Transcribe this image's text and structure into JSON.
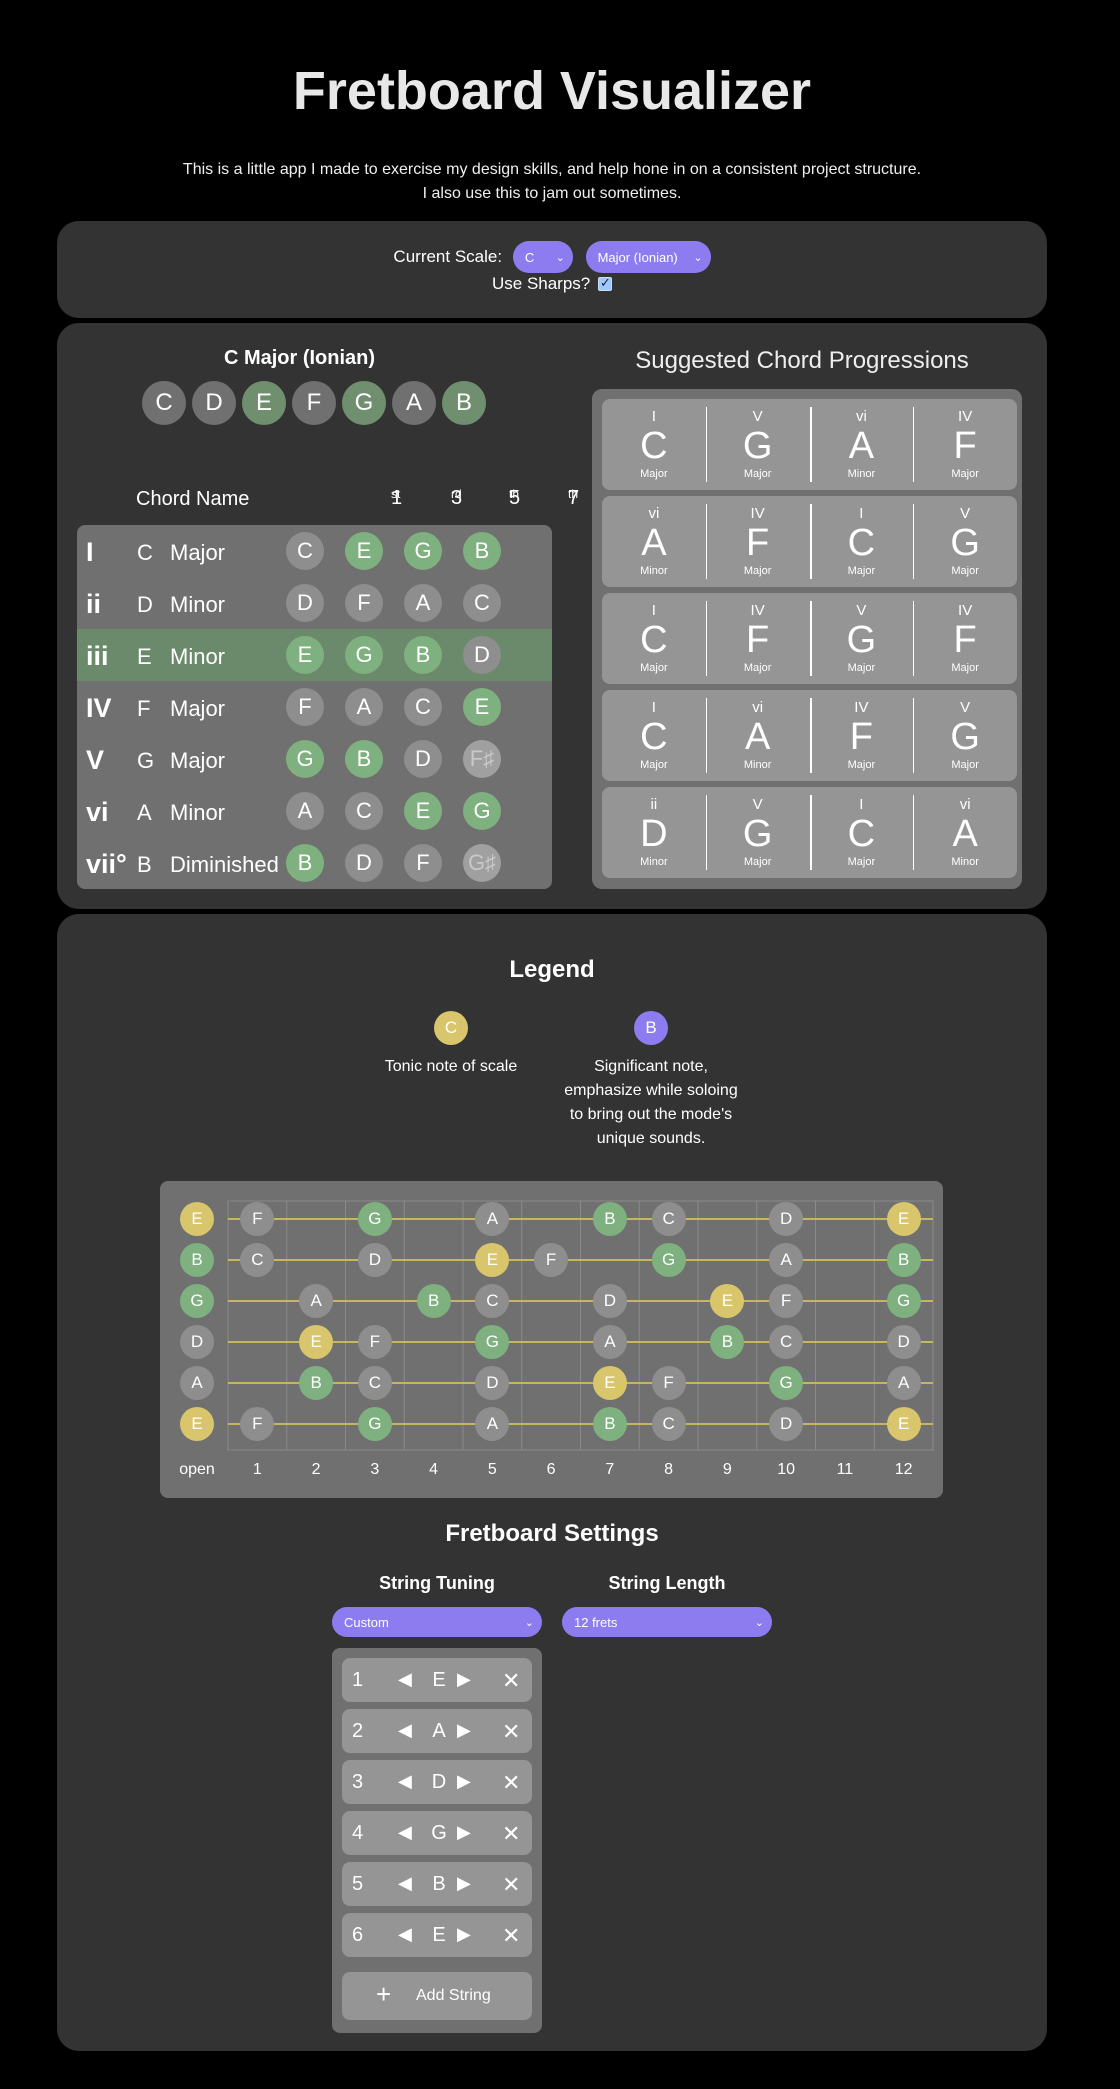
{
  "header": {
    "title": "Fretboard Visualizer",
    "intro_line1": "This is a little app I made to exercise my design skills, and help hone in on a consistent project structure.",
    "intro_line2": "I also use this to jam out sometimes."
  },
  "scale_controls": {
    "label": "Current Scale:",
    "key_value": "C",
    "mode_value": "Major (Ionian)",
    "sharps_label": "Use Sharps?",
    "sharps_checked": true
  },
  "scale": {
    "name": "C Major (Ionian)",
    "notes": [
      "C",
      "D",
      "E",
      "F",
      "G",
      "A",
      "B"
    ],
    "highlighted_notes": [
      "E",
      "G",
      "B"
    ]
  },
  "chord_table": {
    "header_name": "Chord Name",
    "interval_headers": [
      {
        "num": "1",
        "sup": "st"
      },
      {
        "num": "3",
        "sup": "rd"
      },
      {
        "num": "5",
        "sup": "th"
      },
      {
        "num": "7",
        "sup": "th"
      }
    ],
    "highlighted_row": 2,
    "rows": [
      {
        "numeral": "I",
        "root": "C",
        "quality": "Major",
        "notes": [
          "C",
          "E",
          "G",
          "B"
        ],
        "states": [
          "g",
          "s",
          "s",
          "s"
        ]
      },
      {
        "numeral": "ii",
        "root": "D",
        "quality": "Minor",
        "notes": [
          "D",
          "F",
          "A",
          "C"
        ],
        "states": [
          "g",
          "g",
          "g",
          "g"
        ]
      },
      {
        "numeral": "iii",
        "root": "E",
        "quality": "Minor",
        "notes": [
          "E",
          "G",
          "B",
          "D"
        ],
        "states": [
          "s",
          "s",
          "s",
          "g"
        ]
      },
      {
        "numeral": "IV",
        "root": "F",
        "quality": "Major",
        "notes": [
          "F",
          "A",
          "C",
          "E"
        ],
        "states": [
          "g",
          "g",
          "g",
          "s"
        ]
      },
      {
        "numeral": "V",
        "root": "G",
        "quality": "Major",
        "notes": [
          "G",
          "B",
          "D",
          "F♯"
        ],
        "states": [
          "s",
          "s",
          "g",
          "o"
        ]
      },
      {
        "numeral": "vi",
        "root": "A",
        "quality": "Minor",
        "notes": [
          "A",
          "C",
          "E",
          "G"
        ],
        "states": [
          "g",
          "g",
          "s",
          "s"
        ]
      },
      {
        "numeral": "vii°",
        "root": "B",
        "quality": "Diminished",
        "notes": [
          "B",
          "D",
          "F",
          "G♯"
        ],
        "states": [
          "s",
          "g",
          "g",
          "o"
        ]
      }
    ]
  },
  "progressions": {
    "title": "Suggested Chord Progressions",
    "items": [
      [
        {
          "n": "I",
          "c": "C",
          "q": "Major"
        },
        {
          "n": "V",
          "c": "G",
          "q": "Major"
        },
        {
          "n": "vi",
          "c": "A",
          "q": "Minor"
        },
        {
          "n": "IV",
          "c": "F",
          "q": "Major"
        }
      ],
      [
        {
          "n": "vi",
          "c": "A",
          "q": "Minor"
        },
        {
          "n": "IV",
          "c": "F",
          "q": "Major"
        },
        {
          "n": "I",
          "c": "C",
          "q": "Major"
        },
        {
          "n": "V",
          "c": "G",
          "q": "Major"
        }
      ],
      [
        {
          "n": "I",
          "c": "C",
          "q": "Major"
        },
        {
          "n": "IV",
          "c": "F",
          "q": "Major"
        },
        {
          "n": "V",
          "c": "G",
          "q": "Major"
        },
        {
          "n": "IV",
          "c": "F",
          "q": "Major"
        }
      ],
      [
        {
          "n": "I",
          "c": "C",
          "q": "Major"
        },
        {
          "n": "vi",
          "c": "A",
          "q": "Minor"
        },
        {
          "n": "IV",
          "c": "F",
          "q": "Major"
        },
        {
          "n": "V",
          "c": "G",
          "q": "Major"
        }
      ],
      [
        {
          "n": "ii",
          "c": "D",
          "q": "Minor"
        },
        {
          "n": "V",
          "c": "G",
          "q": "Major"
        },
        {
          "n": "I",
          "c": "C",
          "q": "Major"
        },
        {
          "n": "vi",
          "c": "A",
          "q": "Minor"
        }
      ]
    ]
  },
  "legend": {
    "title": "Legend",
    "tonic_note": "C",
    "tonic_text": "Tonic note of scale",
    "significant_note": "B",
    "significant_lines": [
      "Significant note,",
      "emphasize while soloing",
      "to bring out the mode's",
      "unique sounds."
    ]
  },
  "fretboard": {
    "fret_labels": [
      "open",
      "1",
      "2",
      "3",
      "4",
      "5",
      "6",
      "7",
      "8",
      "9",
      "10",
      "11",
      "12"
    ],
    "strings": [
      [
        [
          "E",
          0,
          "y"
        ],
        [
          "F",
          1,
          "g"
        ],
        [
          "G",
          3,
          "s"
        ],
        [
          "A",
          5,
          "g"
        ],
        [
          "B",
          7,
          "s"
        ],
        [
          "C",
          8,
          "g"
        ],
        [
          "D",
          10,
          "g"
        ],
        [
          "E",
          12,
          "y"
        ]
      ],
      [
        [
          "B",
          0,
          "s"
        ],
        [
          "C",
          1,
          "g"
        ],
        [
          "D",
          3,
          "g"
        ],
        [
          "E",
          5,
          "y"
        ],
        [
          "F",
          6,
          "g"
        ],
        [
          "G",
          8,
          "s"
        ],
        [
          "A",
          10,
          "g"
        ],
        [
          "B",
          12,
          "s"
        ]
      ],
      [
        [
          "G",
          0,
          "s"
        ],
        [
          "A",
          2,
          "g"
        ],
        [
          "B",
          4,
          "s"
        ],
        [
          "C",
          5,
          "g"
        ],
        [
          "D",
          7,
          "g"
        ],
        [
          "E",
          9,
          "y"
        ],
        [
          "F",
          10,
          "g"
        ],
        [
          "G",
          12,
          "s"
        ]
      ],
      [
        [
          "D",
          0,
          "g"
        ],
        [
          "E",
          2,
          "y"
        ],
        [
          "F",
          3,
          "g"
        ],
        [
          "G",
          5,
          "s"
        ],
        [
          "A",
          7,
          "g"
        ],
        [
          "B",
          9,
          "s"
        ],
        [
          "C",
          10,
          "g"
        ],
        [
          "D",
          12,
          "g"
        ]
      ],
      [
        [
          "A",
          0,
          "g"
        ],
        [
          "B",
          2,
          "s"
        ],
        [
          "C",
          3,
          "g"
        ],
        [
          "D",
          5,
          "g"
        ],
        [
          "E",
          7,
          "y"
        ],
        [
          "F",
          8,
          "g"
        ],
        [
          "G",
          10,
          "s"
        ],
        [
          "A",
          12,
          "g"
        ]
      ],
      [
        [
          "E",
          0,
          "y"
        ],
        [
          "F",
          1,
          "g"
        ],
        [
          "G",
          3,
          "s"
        ],
        [
          "A",
          5,
          "g"
        ],
        [
          "B",
          7,
          "s"
        ],
        [
          "C",
          8,
          "g"
        ],
        [
          "D",
          10,
          "g"
        ],
        [
          "E",
          12,
          "y"
        ]
      ]
    ]
  },
  "fretboard_settings": {
    "title": "Fretboard Settings",
    "tuning_label": "String Tuning",
    "tuning_value": "Custom",
    "length_label": "String Length",
    "length_value": "12 frets",
    "strings": [
      {
        "num": "1",
        "note": "E"
      },
      {
        "num": "2",
        "note": "A"
      },
      {
        "num": "3",
        "note": "D"
      },
      {
        "num": "4",
        "note": "G"
      },
      {
        "num": "5",
        "note": "B"
      },
      {
        "num": "6",
        "note": "E"
      }
    ],
    "add_label": "Add String"
  },
  "colors": {
    "gray_note": "#8e8e8e",
    "green_note": "#7fb07f",
    "yellow_note": "#d9c56c",
    "purple": "#8c7cf0",
    "faded_note": "#a0a0a0",
    "scale_gray": "#707070",
    "scale_green": "#6f8f6f"
  }
}
